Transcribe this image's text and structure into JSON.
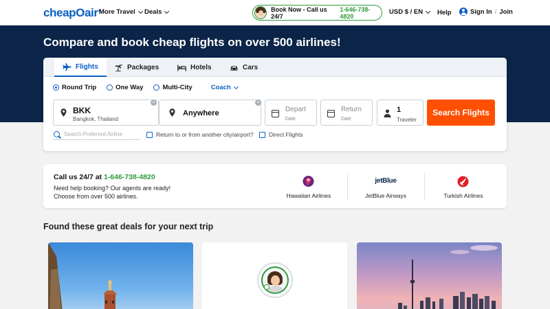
{
  "nav": {
    "logo_text": "cheap",
    "logo_o": "O",
    "logo_suffix": "air",
    "logo_mark": "®",
    "more_travel": "More Travel",
    "deals": "Deals",
    "book_now_label": "Book Now - Call us 24/7",
    "book_now_phone": "1-646-738-4820",
    "currency": "USD $ / EN",
    "help": "Help",
    "sign_in": "Sign In",
    "join": "Join",
    "separator": "/"
  },
  "hero": {
    "title": "Compare and book cheap flights on over 500 airlines!"
  },
  "search": {
    "tabs": [
      {
        "label": "Flights",
        "icon": "airplane-icon",
        "active": true
      },
      {
        "label": "Packages",
        "icon": "palm-tree-plane-icon"
      },
      {
        "label": "Hotels",
        "icon": "bed-icon"
      },
      {
        "label": "Cars",
        "icon": "car-icon"
      }
    ],
    "trip_types": [
      {
        "label": "Round Trip",
        "selected": true
      },
      {
        "label": "One Way"
      },
      {
        "label": "Multi-City"
      }
    ],
    "cabin": "Coach",
    "from_code": "BKK",
    "from_city": "Bangkok, Thailand",
    "to_text": "Anywhere",
    "depart_label": "Depart",
    "depart_sub": "Date",
    "return_label": "Return",
    "return_sub": "Date",
    "travelers_count": "1",
    "travelers_label": "Traveler",
    "clear_symbol": "×",
    "search_button": "Search Flights",
    "airline_placeholder": "Search Preferred Airline",
    "return_other_city": "Return to or from another city/airport?",
    "direct_flights": "Direct Flights"
  },
  "call_panel": {
    "title_prefix": "Call us 24/7 at",
    "phone": "1-646-738-4820",
    "line1": "Need help booking? Our agents are ready!",
    "line2": "Choose from over 500 airlines.",
    "airlines": [
      {
        "name": "Hawaiian Airlines",
        "icon": "hawaiian-airlines-logo"
      },
      {
        "name": "JetBlue Airways",
        "icon": "jetblue-logo",
        "logo_text": "jetBlue"
      },
      {
        "name": "Turkish Airlines",
        "icon": "turkish-airlines-logo"
      }
    ]
  },
  "deals": {
    "title": "Found these great deals for your next trip"
  },
  "colors": {
    "brand_blue": "#0a5ec4",
    "hero_navy": "#0b2447",
    "cta_orange": "#ff4f00",
    "phone_green": "#2e9b3b"
  }
}
